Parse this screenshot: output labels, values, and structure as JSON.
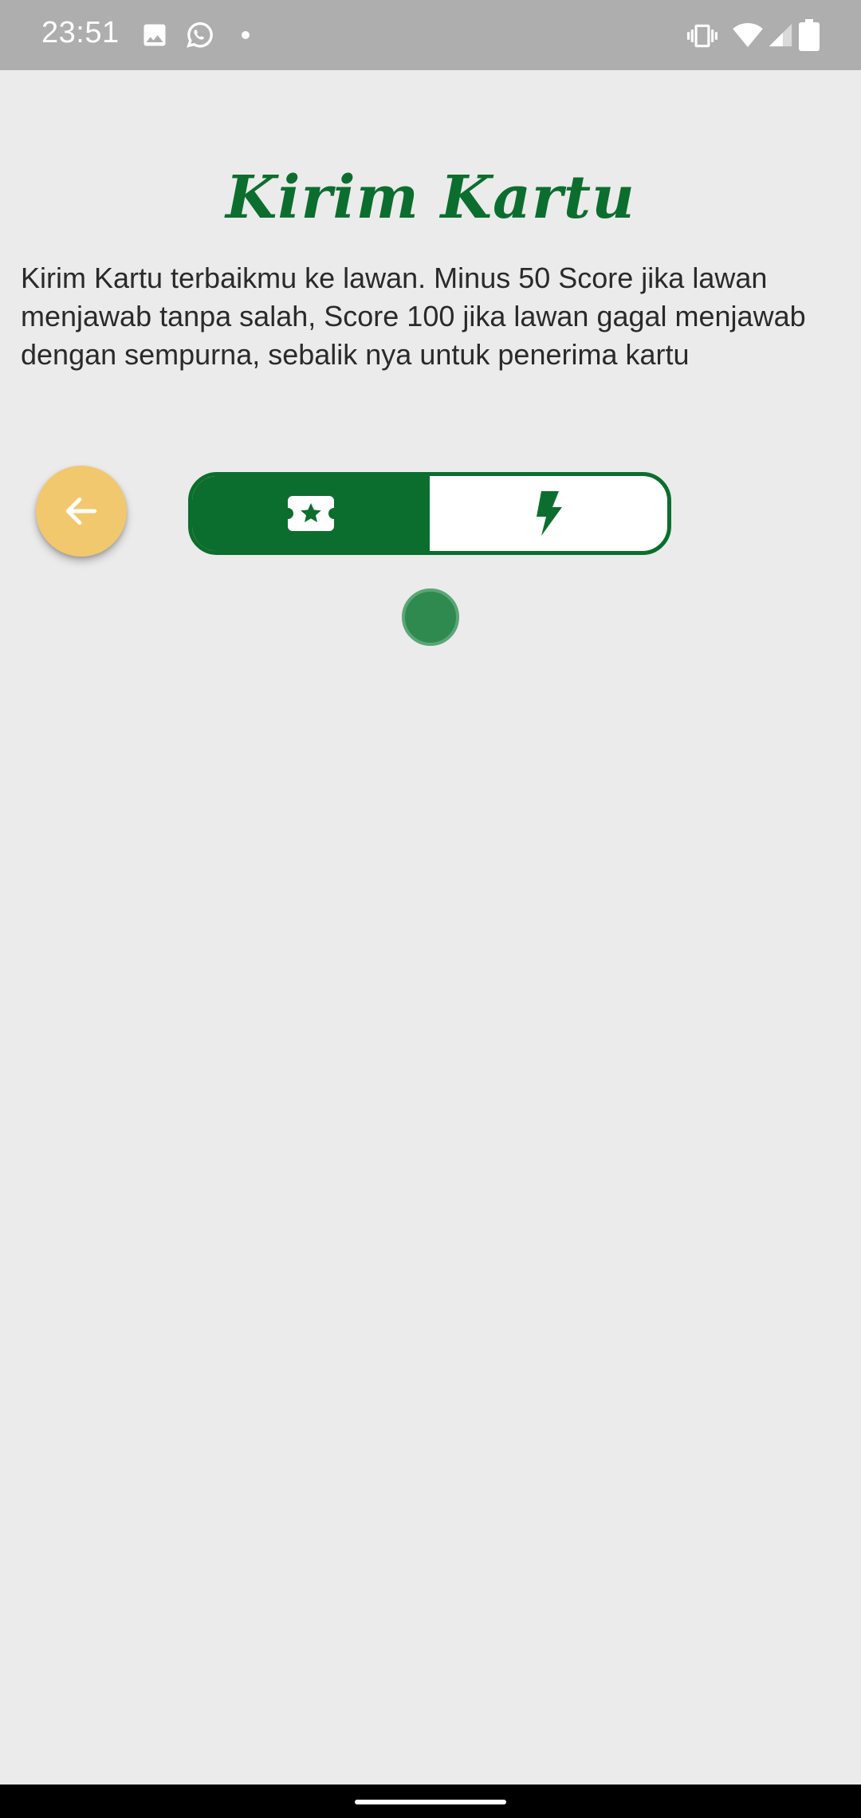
{
  "status_bar": {
    "time": "23:51",
    "left_icons": [
      "image-icon",
      "whatsapp-icon",
      "dot-icon"
    ],
    "right_icons": [
      "vibrate-icon",
      "wifi-icon",
      "signal-icon",
      "battery-icon"
    ]
  },
  "screen": {
    "title": "Kirim Kartu",
    "description": "Kirim Kartu terbaikmu ke lawan. Minus 50 Score jika lawan menjawab tanpa salah, Score 100 jika lawan gagal menjawab dengan sempurna, sebalik nya untuk penerima kartu"
  },
  "controls": {
    "back_icon": "arrow-left-icon",
    "toggle": [
      {
        "icon": "ticket-star-icon",
        "active": true
      },
      {
        "icon": "lightning-icon",
        "active": false
      }
    ]
  },
  "colors": {
    "primary_green": "#0c6e2e",
    "back_button": "#f2c86e",
    "background": "#ebebeb",
    "status_bar": "#aeaeae"
  }
}
